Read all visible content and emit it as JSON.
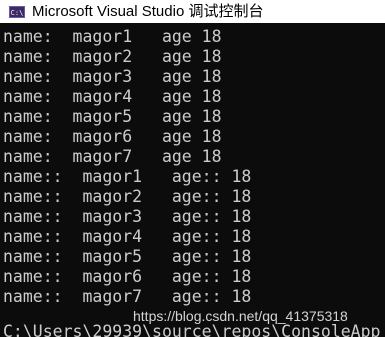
{
  "window": {
    "title": "Microsoft Visual Studio 调试控制台",
    "icon": "console-app-icon",
    "icon_text": "C:\\"
  },
  "console": {
    "lines": [
      "name:  magor1   age 18",
      "name:  magor2   age 18",
      "name:  magor3   age 18",
      "name:  magor4   age 18",
      "name:  magor5   age 18",
      "name:  magor6   age 18",
      "name:  magor7   age 18",
      "name::  magor1   age:: 18",
      "name::  magor2   age:: 18",
      "name::  magor3   age:: 18",
      "name::  magor4   age:: 18",
      "name::  magor5   age:: 18",
      "name::  magor6   age:: 18",
      "name::  magor7   age:: 18",
      "C:\\Users\\29939\\source\\repos\\ConsoleApp"
    ],
    "text_color": "#cccccc",
    "background_color": "#0c0c0c"
  },
  "watermark": {
    "text": "https://blog.csdn.net/qq_41375318"
  }
}
